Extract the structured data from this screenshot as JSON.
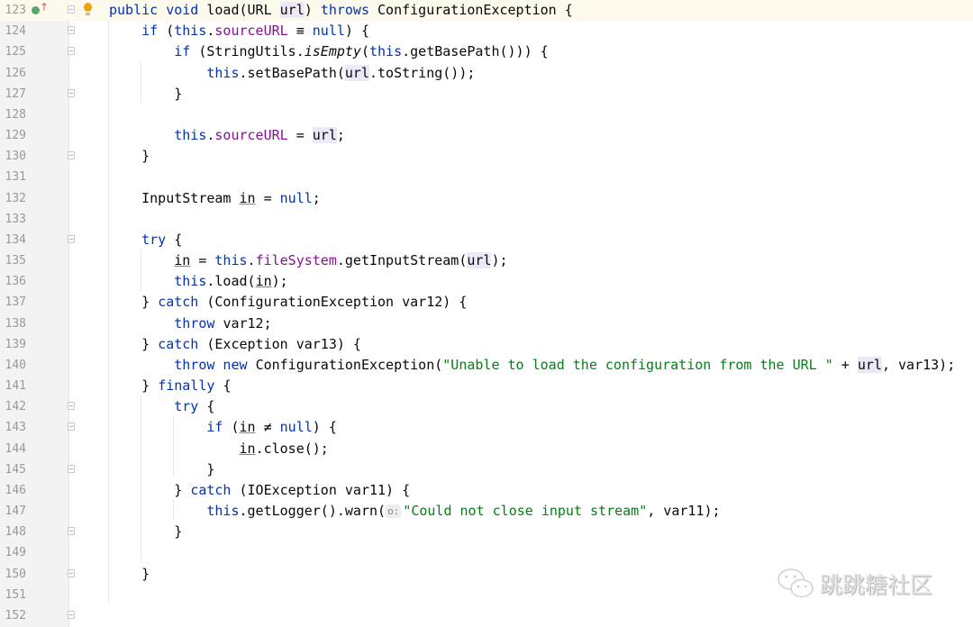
{
  "editor": {
    "lines": [
      {
        "n": "123",
        "current": true,
        "fold": true,
        "tokens": [
          [
            "kw",
            "public void "
          ],
          [
            "",
            "load(URL "
          ],
          [
            "hl",
            "url"
          ],
          [
            "",
            ") "
          ],
          [
            "kw",
            "throws "
          ],
          [
            "",
            "ConfigurationException {"
          ]
        ]
      },
      {
        "n": "124",
        "fold": true,
        "tokens": [
          [
            "",
            "    "
          ],
          [
            "kw",
            "if "
          ],
          [
            "",
            "("
          ],
          [
            "kw",
            "this"
          ],
          [
            "",
            "."
          ],
          [
            "field",
            "sourceURL"
          ],
          [
            "",
            " ≡ "
          ],
          [
            "kw",
            "null"
          ],
          [
            "",
            ") {"
          ]
        ]
      },
      {
        "n": "125",
        "fold": true,
        "tokens": [
          [
            "",
            "        "
          ],
          [
            "kw",
            "if "
          ],
          [
            "",
            "(StringUtils."
          ],
          [
            "it",
            "isEmpty"
          ],
          [
            "",
            "("
          ],
          [
            "kw",
            "this"
          ],
          [
            "",
            ".getBasePath())) {"
          ]
        ]
      },
      {
        "n": "126",
        "tokens": [
          [
            "",
            "            "
          ],
          [
            "kw",
            "this"
          ],
          [
            "",
            ".setBasePath("
          ],
          [
            "hl",
            "url"
          ],
          [
            "",
            ".toString());"
          ]
        ]
      },
      {
        "n": "127",
        "fold": true,
        "tokens": [
          [
            "",
            "        }"
          ]
        ]
      },
      {
        "n": "128",
        "tokens": []
      },
      {
        "n": "129",
        "tokens": [
          [
            "",
            "        "
          ],
          [
            "kw",
            "this"
          ],
          [
            "",
            "."
          ],
          [
            "field",
            "sourceURL"
          ],
          [
            "",
            " = "
          ],
          [
            "hl",
            "url"
          ],
          [
            "",
            ";"
          ]
        ]
      },
      {
        "n": "130",
        "fold": true,
        "tokens": [
          [
            "",
            "    }"
          ]
        ]
      },
      {
        "n": "131",
        "tokens": []
      },
      {
        "n": "132",
        "tokens": [
          [
            "",
            "    InputStream "
          ],
          [
            "ul",
            "in"
          ],
          [
            "",
            " = "
          ],
          [
            "kw",
            "null"
          ],
          [
            "",
            ";"
          ]
        ]
      },
      {
        "n": "133",
        "tokens": []
      },
      {
        "n": "134",
        "fold": true,
        "tokens": [
          [
            "",
            "    "
          ],
          [
            "kw",
            "try "
          ],
          [
            "",
            "{"
          ]
        ]
      },
      {
        "n": "135",
        "tokens": [
          [
            "",
            "        "
          ],
          [
            "ul",
            "in"
          ],
          [
            "",
            " = "
          ],
          [
            "kw",
            "this"
          ],
          [
            "",
            "."
          ],
          [
            "field",
            "fileSystem"
          ],
          [
            "",
            ".getInputStream("
          ],
          [
            "hl",
            "url"
          ],
          [
            "",
            ");"
          ]
        ]
      },
      {
        "n": "136",
        "tokens": [
          [
            "",
            "        "
          ],
          [
            "kw",
            "this"
          ],
          [
            "",
            ".load("
          ],
          [
            "ul",
            "in"
          ],
          [
            "",
            ");"
          ]
        ]
      },
      {
        "n": "137",
        "tokens": [
          [
            "",
            "    } "
          ],
          [
            "kw",
            "catch "
          ],
          [
            "",
            "(ConfigurationException var12) {"
          ]
        ]
      },
      {
        "n": "138",
        "tokens": [
          [
            "",
            "        "
          ],
          [
            "kw",
            "throw "
          ],
          [
            "",
            "var12;"
          ]
        ]
      },
      {
        "n": "139",
        "tokens": [
          [
            "",
            "    } "
          ],
          [
            "kw",
            "catch "
          ],
          [
            "",
            "(Exception var13) {"
          ]
        ]
      },
      {
        "n": "140",
        "tokens": [
          [
            "",
            "        "
          ],
          [
            "kw",
            "throw new "
          ],
          [
            "",
            "ConfigurationException("
          ],
          [
            "str",
            "\"Unable to load the configuration from the URL \""
          ],
          [
            "",
            " + "
          ],
          [
            "hl",
            "url"
          ],
          [
            "",
            ", var13);"
          ]
        ]
      },
      {
        "n": "141",
        "tokens": [
          [
            "",
            "    } "
          ],
          [
            "kw",
            "finally "
          ],
          [
            "",
            "{"
          ]
        ]
      },
      {
        "n": "142",
        "fold": true,
        "tokens": [
          [
            "",
            "        "
          ],
          [
            "kw",
            "try "
          ],
          [
            "",
            "{"
          ]
        ]
      },
      {
        "n": "143",
        "fold": true,
        "tokens": [
          [
            "",
            "            "
          ],
          [
            "kw",
            "if "
          ],
          [
            "",
            "("
          ],
          [
            "ul",
            "in"
          ],
          [
            "",
            " ≠ "
          ],
          [
            "kw",
            "null"
          ],
          [
            "",
            ") {"
          ]
        ]
      },
      {
        "n": "144",
        "tokens": [
          [
            "",
            "                "
          ],
          [
            "ul",
            "in"
          ],
          [
            "",
            ".close();"
          ]
        ]
      },
      {
        "n": "145",
        "fold": true,
        "tokens": [
          [
            "",
            "            }"
          ]
        ]
      },
      {
        "n": "146",
        "tokens": [
          [
            "",
            "        } "
          ],
          [
            "kw",
            "catch "
          ],
          [
            "",
            "(IOException var11) {"
          ]
        ]
      },
      {
        "n": "147",
        "tokens": [
          [
            "",
            "            "
          ],
          [
            "kw",
            "this"
          ],
          [
            "",
            ".getLogger().warn("
          ],
          [
            "hint",
            "o:"
          ],
          [
            "str",
            "\"Could not close input stream\""
          ],
          [
            "",
            ", var11);"
          ]
        ]
      },
      {
        "n": "148",
        "fold": true,
        "tokens": [
          [
            "",
            "        }"
          ]
        ]
      },
      {
        "n": "149",
        "tokens": []
      },
      {
        "n": "150",
        "fold": true,
        "tokens": [
          [
            "",
            "    }"
          ]
        ]
      },
      {
        "n": "151",
        "tokens": []
      },
      {
        "n": "152",
        "fold": true,
        "tokens": [
          [
            "}"
          ]
        ]
      }
    ]
  },
  "icons": {
    "implements": "implements-method-icon",
    "bulb": "intention-bulb-icon"
  },
  "colors": {
    "keyword": "#0033b3",
    "field": "#871094",
    "string": "#067d17",
    "current_line": "#fcfaed"
  },
  "watermark": {
    "text": "跳跳糖社区"
  }
}
